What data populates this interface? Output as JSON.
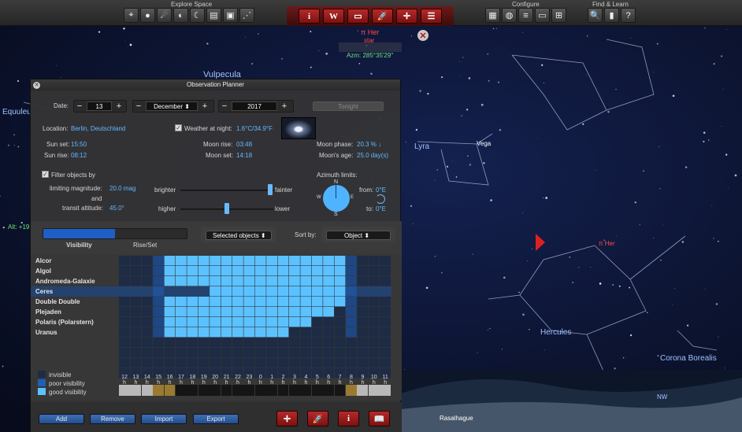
{
  "toolbar": {
    "explore_title": "Explore Space",
    "configure_title": "Configure",
    "find_title": "Find & Learn",
    "explore_icons": [
      "telescope-icon",
      "planet-icon",
      "comet-icon",
      "moon-phase-icon",
      "moon-icon",
      "book-icon",
      "frame-icon",
      "constellation-icon"
    ],
    "center_icons": [
      {
        "name": "info-icon",
        "glyph": "i"
      },
      {
        "name": "wikipedia-icon",
        "glyph": "W"
      },
      {
        "name": "book-icon",
        "glyph": "▭"
      },
      {
        "name": "rocket-icon",
        "glyph": "🚀"
      },
      {
        "name": "center-icon",
        "glyph": "✛"
      },
      {
        "name": "table-icon",
        "glyph": "☰"
      }
    ],
    "configure_icons": [
      "box-icon",
      "globe-icon",
      "sliders-icon",
      "panel-icon",
      "add-window-icon"
    ],
    "find_icons": [
      {
        "name": "search-icon",
        "glyph": "🔍"
      },
      {
        "name": "pane-icon",
        "glyph": "▮"
      },
      {
        "name": "help-icon",
        "glyph": "?"
      }
    ]
  },
  "sky": {
    "selected_name": "π Her",
    "selected_type": "star",
    "azimuth": "Azm: 285°35'29\"",
    "labels": {
      "vulpecula": "Vulpecula",
      "equuleus": "Equuleu",
      "lyra": "Lyra",
      "vega": "Vega",
      "pi_her": "π Her",
      "hercules": "Hercules",
      "corona": "Corona Borealis",
      "rasalhague": "Rasalhague",
      "alt": "Alt: +19",
      "nw": "NW"
    }
  },
  "planner": {
    "title": "Observation Planner",
    "date_label": "Date:",
    "day": "13",
    "month": "December",
    "year": "2017",
    "tonight_label": "Tonight",
    "location_label": "Location:",
    "location_value": "Berlin, Deutschland",
    "weather_label": "Weather at night:",
    "weather_value": "1.6°C/34.9°F",
    "sun_set_label": "Sun set:",
    "sun_set": "15:50",
    "sun_rise_label": "Sun rise:",
    "sun_rise": "08:12",
    "moon_rise_label": "Moon rise:",
    "moon_rise": "03:48",
    "moon_set_label": "Moon set:",
    "moon_set": "14:18",
    "moon_phase_label": "Moon phase:",
    "moon_phase": "20.3 % ↓",
    "moon_age_label": "Moon's age:",
    "moon_age": "25.0 day(s)",
    "filter_label": "Filter objects by",
    "limiting_label": "limiting magnitude:",
    "limiting_value": "20.0 mag",
    "and_label": "and",
    "transit_label": "transit altitude:",
    "transit_value": "45.0°",
    "brighter": "brighter",
    "fainter": "fainter",
    "higher": "higher",
    "lower": "lower",
    "magnitude_slider_fraction": 0.97,
    "altitude_slider_fraction": 0.5,
    "azimuth_label": "Azimuth limits:",
    "az_from_label": "from:",
    "az_from": "0°E",
    "az_to_label": "to:",
    "az_to": "0°E",
    "compass": {
      "n": "N",
      "s": "S",
      "e": "E",
      "w": "W"
    },
    "tab_visibility": "Visibility",
    "tab_riseset": "Rise/Set",
    "selected_objects": "Selected objects",
    "sort_label": "Sort by:",
    "sort_value": "Object",
    "objects": [
      {
        "name": "Alcor",
        "visible_from": 4,
        "visible_to": 20
      },
      {
        "name": "Algol",
        "visible_from": 4,
        "visible_to": 20
      },
      {
        "name": "Andromeda-Galaxie",
        "visible_from": 4,
        "visible_to": 20
      },
      {
        "name": "Ceres",
        "visible_from": 8,
        "visible_to": 20
      },
      {
        "name": "Double Double",
        "visible_from": 4,
        "visible_to": 20
      },
      {
        "name": "Plejaden",
        "visible_from": 4,
        "visible_to": 19
      },
      {
        "name": "Polaris (Polarstern)",
        "visible_from": 4,
        "visible_to": 17
      },
      {
        "name": "Uranus",
        "visible_from": 4,
        "visible_to": 15
      }
    ],
    "selected_row": 3,
    "legend": {
      "invisible": "invisible",
      "poor": "poor visibility",
      "good": "good visibility"
    },
    "colors": {
      "invisible": "#1e2b45",
      "poor": "#1f5fb8",
      "good": "#5cc2ff",
      "selected": "#24426e"
    },
    "hours": [
      "12",
      "13",
      "14",
      "15",
      "16",
      "17",
      "18",
      "19",
      "20",
      "21",
      "22",
      "23",
      "0",
      "1",
      "2",
      "3",
      "4",
      "5",
      "6",
      "7",
      "8",
      "9",
      "10",
      "11"
    ],
    "hour_suffix": "h",
    "buttons": {
      "add": "Add",
      "remove": "Remove",
      "import": "Import",
      "export": "Export"
    },
    "bottom_icons": [
      {
        "name": "center-icon",
        "glyph": "✛"
      },
      {
        "name": "rocket-icon",
        "glyph": "🚀"
      },
      {
        "name": "info-icon",
        "glyph": "i"
      },
      {
        "name": "book-icon",
        "glyph": "📖"
      }
    ]
  }
}
